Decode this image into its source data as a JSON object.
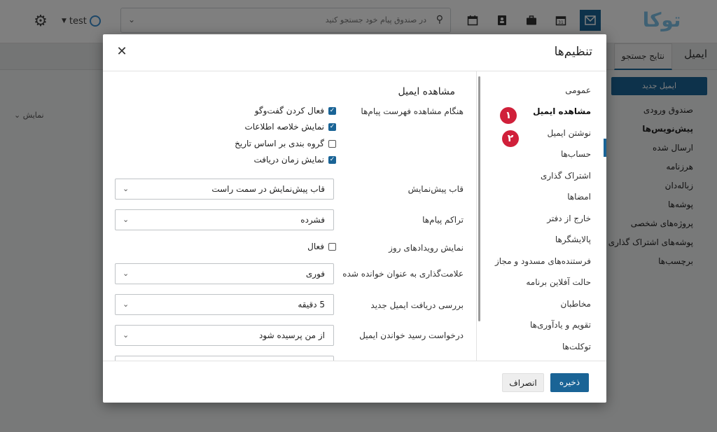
{
  "topbar": {
    "user_name": "test",
    "search_placeholder": "در صندوق پیام خود جستجو کنید",
    "logo_text": "توکا",
    "icons": [
      "calendar-icon",
      "contacts-icon",
      "briefcase-icon",
      "calendar-day-icon",
      "mail-icon"
    ]
  },
  "background": {
    "tab_mail": "ایمیل",
    "tab_search_results": "نتایج جستجو",
    "new_mail_button": "ایمیل جدید",
    "folders": [
      "صندوق ورودی",
      "پیش‌نویس‌ها",
      "ارسال شده",
      "هرزنامه",
      "زباله‌دان",
      "پوشه‌ها",
      "پروژه‌های شخصی",
      "پوشه‌های اشتراک گذاری",
      "برچسب‌ها"
    ],
    "show_label": "نمایش"
  },
  "modal": {
    "title": "تنظیم‌ها",
    "nav": [
      "عمومی",
      "مشاهده ایمیل",
      "نوشتن ایمیل",
      "حساب‌ها",
      "اشتراک گذاری",
      "امضاها",
      "خارج از دفتر",
      "پالایشگرها",
      "فرستنده‌های مسدود و مجاز",
      "حالت آفلاین برنامه",
      "مخاطبان",
      "تقویم و یادآوری‌ها",
      "توکلت‌ها"
    ],
    "badges": [
      "۱",
      "۲"
    ],
    "section_title": "مشاهده ایمیل",
    "list_view_label": "هنگام مشاهده فهرست پیام‌ها",
    "checkboxes": [
      {
        "label": "فعال کردن گفت‌وگو",
        "checked": true
      },
      {
        "label": "نمایش خلاصه اطلاعات",
        "checked": true
      },
      {
        "label": "گروه بندی بر اساس تاریخ",
        "checked": false
      },
      {
        "label": "نمایش زمان دریافت",
        "checked": true
      }
    ],
    "preview_label": "قاب پیش‌نمایش",
    "preview_value": "قاب پیش‌نمایش در سمت راست",
    "density_label": "تراکم پیام‌ها",
    "density_value": "فشرده",
    "events_label": "نمایش رویدادهای روز",
    "events_checkbox": "فعال",
    "mark_read_label": "علامت‌گذاری به عنوان خوانده شده",
    "mark_read_value": "فوری",
    "check_new_label": "بررسی دریافت ایمیل جدید",
    "check_new_value": "5 دقیقه",
    "read_receipt_label": "درخواست رسید خواندن ایمیل",
    "read_receipt_value": "از من پرسیده شود",
    "save_button": "ذخیره",
    "cancel_button": "انصراف"
  },
  "colors": {
    "accent": "#1a6496",
    "badge": "#d0203a"
  }
}
